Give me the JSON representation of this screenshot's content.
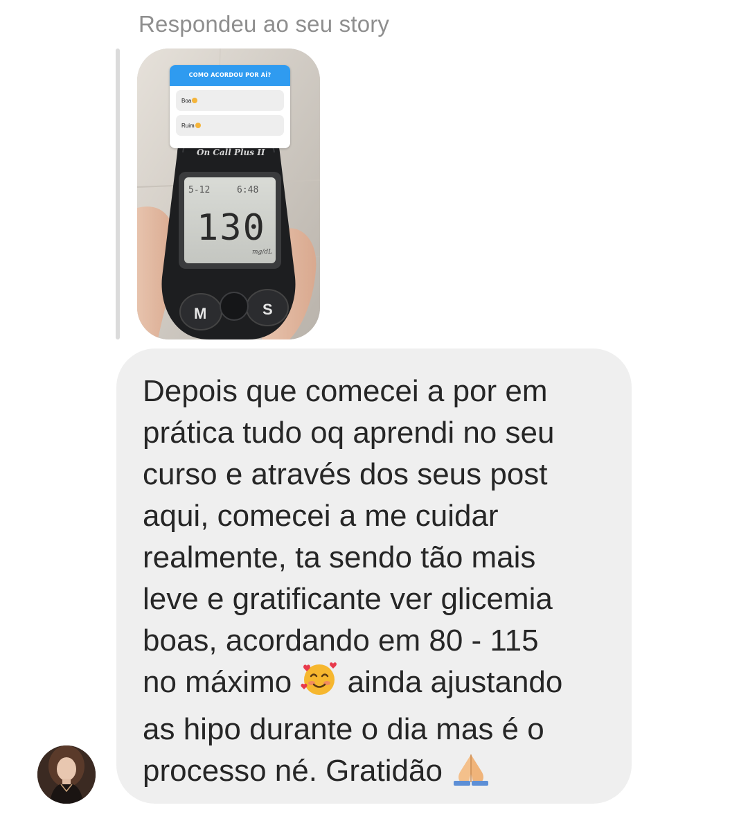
{
  "reply": {
    "header": "Respondeu ao seu story"
  },
  "story": {
    "poll_title": "COMO ACORDOU POR AÍ?",
    "poll_options": [
      "Boa",
      "Ruim"
    ],
    "meter_brand": "On Call Plus II",
    "meter_date": "5-12",
    "meter_time": "6:48",
    "meter_reading": "130",
    "meter_unit": "mg/dL",
    "meter_button_left": "M",
    "meter_button_right": "S"
  },
  "message": {
    "line1": "Depois que comecei a por em",
    "line2": "prática tudo oq aprendi no seu",
    "line3": "curso e através dos seus post",
    "line4": "aqui, comecei a me cuidar",
    "line5": "realmente, ta sendo tão mais",
    "line6": "leve e gratificante ver glicemia",
    "line7": "boas, acordando em 80 - 115",
    "line8a": "no máximo",
    "line8b": "ainda ajustando",
    "line9": "as hipo durante o dia mas é o",
    "line10": "processo né. Gratidão"
  },
  "icons": {
    "smiling_face_hearts": "smiling-face-with-hearts-emoji",
    "folded_hands": "folded-hands-emoji",
    "avatar": "user-avatar"
  },
  "colors": {
    "bubble_bg": "#efefef",
    "text": "#262626",
    "header_text": "#8e8e8e",
    "poll_header": "#2f9bf0"
  }
}
